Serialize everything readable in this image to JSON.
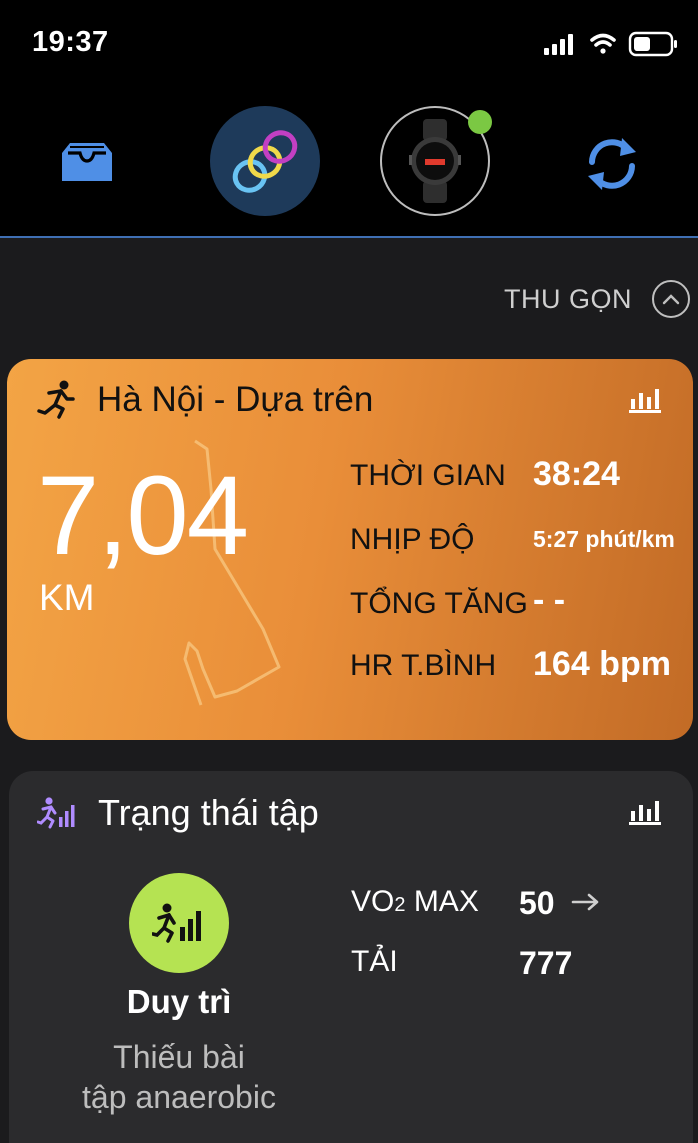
{
  "status_bar": {
    "time": "19:37",
    "icons": [
      "signal-icon",
      "wifi-icon",
      "battery-icon"
    ]
  },
  "header": {
    "buttons": [
      "inbox-icon",
      "connect-icon",
      "device-watch",
      "sync-icon"
    ],
    "colors": {
      "accent_blue": "#4f8fe6",
      "device_status": "#7bc843"
    }
  },
  "collapse": {
    "label": "THU GỌN"
  },
  "activity": {
    "title": "Hà Nội - Dựa trên",
    "distance": "7,04",
    "unit": "KM",
    "stats": [
      {
        "label": "THỜI GIAN",
        "value": "38:24"
      },
      {
        "label": "NHỊP ĐỘ",
        "value": "5:27 phút/km"
      },
      {
        "label": "TỔNG TĂNG",
        "value": "- -"
      },
      {
        "label": "HR T.BÌNH",
        "value": "164 bpm"
      }
    ],
    "colors": {
      "gradient_start": "#f3a445",
      "gradient_end": "#c26b26"
    }
  },
  "training": {
    "title": "Trạng thái tập",
    "status": "Duy trì",
    "description_line1": "Thiếu bài",
    "description_line2": "tập anaerobic",
    "metrics": [
      {
        "label_main": "VO",
        "label_sub": "2",
        "label_rest": " MAX",
        "value": "50"
      },
      {
        "label": "TẢI",
        "value": "777"
      }
    ],
    "colors": {
      "badge": "#b5e352",
      "title_icon": "#b08cff"
    }
  }
}
